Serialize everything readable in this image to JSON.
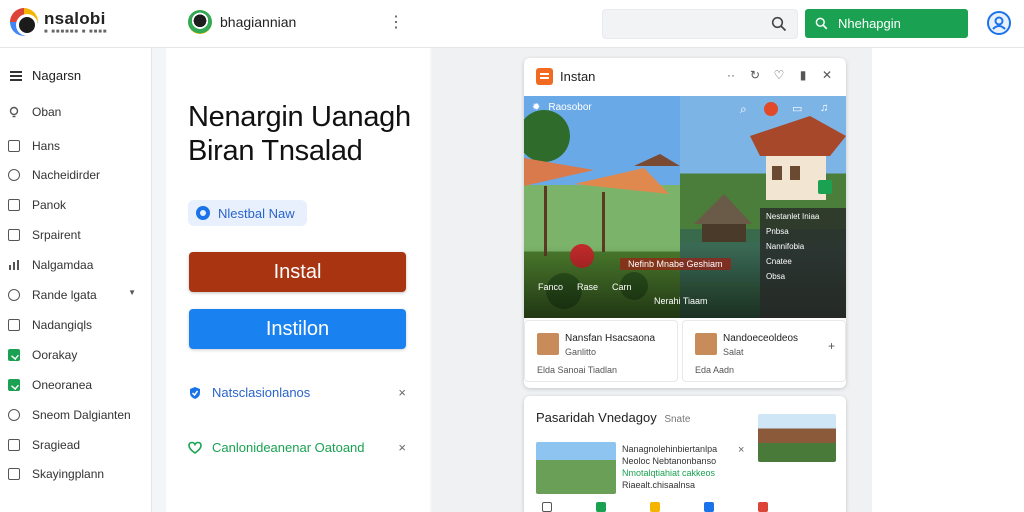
{
  "app": {
    "brand_name": "nsalobi",
    "brand_sub": "■ ■■■■■■ ■ ■■■■",
    "account_name": "bhagiannian",
    "search_placeholder": "",
    "top_cta": "Nhehapgin"
  },
  "sidebar": {
    "header": "Nagarsn",
    "items": [
      {
        "label": "Oban"
      },
      {
        "label": "Hans"
      },
      {
        "label": "Nacheidirder"
      },
      {
        "label": "Panok"
      },
      {
        "label": "Srpairent"
      },
      {
        "label": "Nalgamdaa"
      },
      {
        "label": "Rande lgata"
      },
      {
        "label": "Nadangiqls"
      },
      {
        "label": "Oorakay"
      },
      {
        "label": "Oneoranea"
      },
      {
        "label": "Sneom Dalgianten"
      },
      {
        "label": "Sragiead"
      },
      {
        "label": "Skayingplann"
      }
    ]
  },
  "main": {
    "headline_line1": "Nenargin Uanagh",
    "headline_line2": "Biran Tnsalad",
    "pill_label": "Nlestbal Naw",
    "install_primary": "Instal",
    "install_secondary": "Instilon",
    "notices": [
      {
        "text": "Natsclasionlanos",
        "close": "×"
      },
      {
        "text": "Canlonideanenar Oatoand",
        "close": "×"
      }
    ]
  },
  "card": {
    "title": "Instan",
    "hero_tag": "Raosobor",
    "hero_badge": "Nefinb Mnabe Geshiam",
    "hero_meta": [
      "Fanco",
      "Rase",
      "Carn"
    ],
    "hero_meta2": "Nerahi Tiaam",
    "side_panel": [
      "Nestanlet Iniaa",
      "Pnbsa",
      "Nannifobia",
      "Cnatee",
      "Obsa"
    ],
    "subcards": [
      {
        "t1": "Nansfan Hsacsaona",
        "t2": "Ganlitto",
        "t3": "Elda  Sanoai Tiadlan"
      },
      {
        "t1": "Nandoeceoldeos",
        "t2": "Salat",
        "t3": "Eda  Aadn"
      }
    ]
  },
  "card2": {
    "title": "Pasaridah Vnedagoy",
    "muted": "Snate",
    "lines": [
      "Nanagnolehinbiertanlpa",
      "Neoloc Nebtanonbanso",
      "Nmotalqtiahiat cakkeos",
      "Riaealt.chisaalnsa"
    ]
  },
  "colors": {
    "accent_green": "#1aa252",
    "install_red": "#a83412",
    "install_blue": "#1a82f0",
    "pill_blue": "#2a64c9"
  }
}
